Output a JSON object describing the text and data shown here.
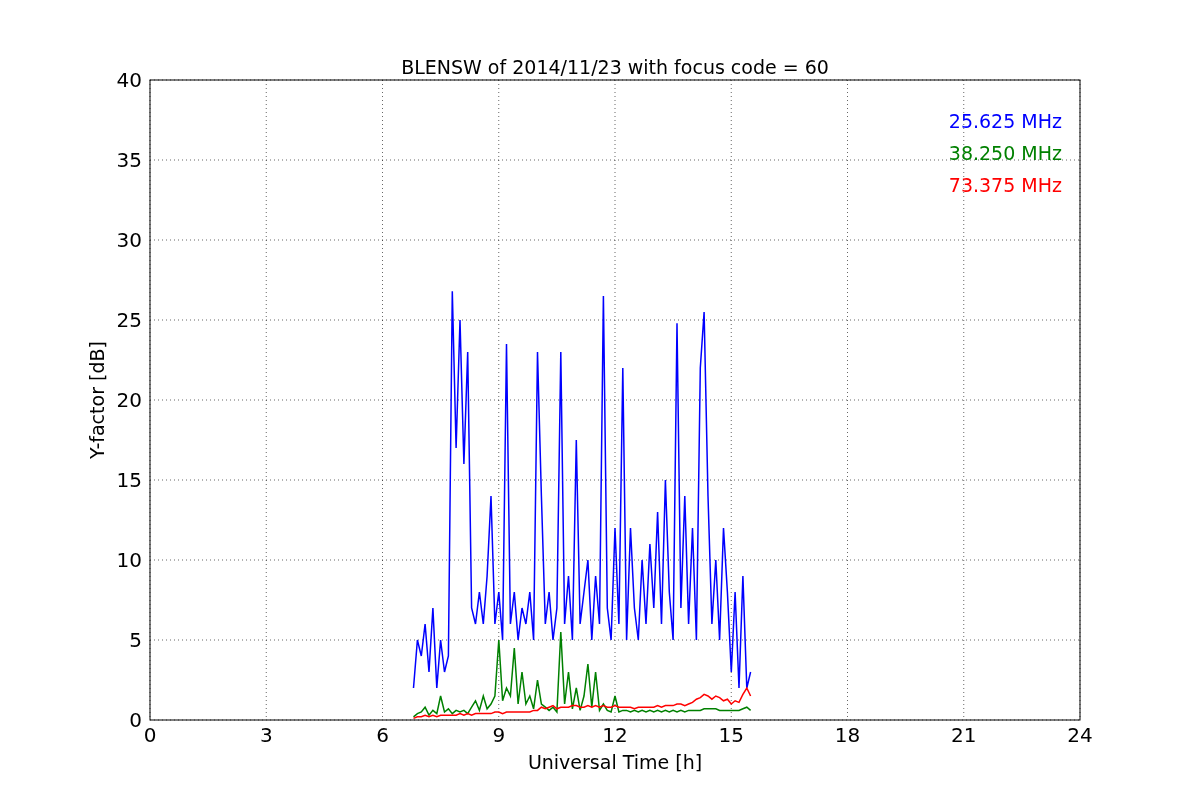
{
  "chart_data": {
    "type": "line",
    "title": "BLENSW of 2014/11/23 with focus code = 60",
    "xlabel": "Universal Time [h]",
    "ylabel": "Y-factor [dB]",
    "x": [
      6.8,
      6.9,
      7.0,
      7.1,
      7.2,
      7.3,
      7.4,
      7.5,
      7.6,
      7.7,
      7.8,
      7.9,
      8.0,
      8.1,
      8.2,
      8.3,
      8.4,
      8.5,
      8.6,
      8.7,
      8.8,
      8.9,
      9.0,
      9.1,
      9.2,
      9.3,
      9.4,
      9.5,
      9.6,
      9.7,
      9.8,
      9.9,
      10.0,
      10.1,
      10.2,
      10.3,
      10.4,
      10.5,
      10.6,
      10.7,
      10.8,
      10.9,
      11.0,
      11.1,
      11.2,
      11.3,
      11.4,
      11.5,
      11.6,
      11.7,
      11.8,
      11.9,
      12.0,
      12.1,
      12.2,
      12.3,
      12.4,
      12.5,
      12.6,
      12.7,
      12.8,
      12.9,
      13.0,
      13.1,
      13.2,
      13.3,
      13.4,
      13.5,
      13.6,
      13.7,
      13.8,
      13.9,
      14.0,
      14.1,
      14.2,
      14.3,
      14.4,
      14.5,
      14.6,
      14.7,
      14.8,
      14.9,
      15.0,
      15.1,
      15.2,
      15.3,
      15.4,
      15.5
    ],
    "series": [
      {
        "name": "25.625 MHz",
        "color": "#0000ff",
        "values": [
          2,
          5,
          4,
          6,
          3,
          7,
          2,
          5,
          3,
          4,
          26.8,
          17,
          25,
          16,
          23,
          7,
          6,
          8,
          6,
          9,
          14,
          6,
          8,
          5,
          23.5,
          6,
          8,
          5,
          7,
          6,
          8,
          5,
          23,
          14,
          6,
          8,
          5,
          7,
          23,
          6,
          9,
          5,
          17.5,
          6,
          8,
          10,
          5,
          9,
          6,
          26.5,
          7,
          5,
          12,
          6,
          22,
          5,
          12,
          7,
          5,
          10,
          6,
          11,
          7,
          13,
          6,
          15,
          8,
          5,
          24.8,
          7,
          14,
          6,
          12,
          5,
          22,
          25.5,
          14,
          6,
          10,
          5,
          12,
          8,
          3,
          8,
          2,
          9,
          2,
          3
        ]
      },
      {
        "name": "38.250 MHz",
        "color": "#008000",
        "values": [
          0.2,
          0.4,
          0.5,
          0.8,
          0.3,
          0.6,
          0.4,
          1.5,
          0.5,
          0.7,
          0.4,
          0.6,
          0.5,
          0.6,
          0.4,
          0.8,
          1.2,
          0.6,
          1.5,
          0.7,
          1.0,
          1.5,
          5,
          1.2,
          2,
          1.5,
          4.5,
          1,
          3,
          1,
          1.5,
          0.7,
          2.5,
          1,
          0.8,
          0.6,
          0.8,
          0.5,
          5.5,
          1,
          3,
          0.7,
          2,
          0.6,
          1.5,
          3.5,
          0.8,
          3,
          0.6,
          1,
          0.6,
          0.5,
          1.5,
          0.5,
          0.6,
          0.6,
          0.5,
          0.6,
          0.5,
          0.6,
          0.5,
          0.6,
          0.5,
          0.6,
          0.5,
          0.6,
          0.5,
          0.6,
          0.5,
          0.6,
          0.5,
          0.6,
          0.6,
          0.6,
          0.6,
          0.7,
          0.7,
          0.7,
          0.7,
          0.6,
          0.6,
          0.6,
          0.6,
          0.6,
          0.6,
          0.7,
          0.8,
          0.6
        ]
      },
      {
        "name": "73.375 MHz",
        "color": "#ff0000",
        "values": [
          0.1,
          0.2,
          0.2,
          0.3,
          0.2,
          0.3,
          0.2,
          0.3,
          0.3,
          0.3,
          0.3,
          0.3,
          0.4,
          0.3,
          0.4,
          0.3,
          0.4,
          0.4,
          0.4,
          0.4,
          0.4,
          0.5,
          0.5,
          0.4,
          0.5,
          0.5,
          0.5,
          0.5,
          0.5,
          0.5,
          0.5,
          0.6,
          0.6,
          0.8,
          0.7,
          0.8,
          0.9,
          0.7,
          0.8,
          0.8,
          0.8,
          0.9,
          0.9,
          0.8,
          0.8,
          0.9,
          0.8,
          0.9,
          0.8,
          0.9,
          0.8,
          0.8,
          0.9,
          0.8,
          0.8,
          0.8,
          0.8,
          0.7,
          0.8,
          0.8,
          0.8,
          0.8,
          0.8,
          0.9,
          0.8,
          0.9,
          0.9,
          0.9,
          1.0,
          1.0,
          0.9,
          1.0,
          1.1,
          1.3,
          1.4,
          1.6,
          1.5,
          1.3,
          1.5,
          1.4,
          1.2,
          1.3,
          1.0,
          1.2,
          1.1,
          1.6,
          2.0,
          1.5
        ]
      }
    ],
    "grid": true,
    "xlim": [
      0,
      24
    ],
    "ylim": [
      0,
      40
    ],
    "xticks": [
      0,
      3,
      6,
      9,
      12,
      15,
      18,
      21,
      24
    ],
    "yticks": [
      0,
      5,
      10,
      15,
      20,
      25,
      30,
      35,
      40
    ]
  }
}
